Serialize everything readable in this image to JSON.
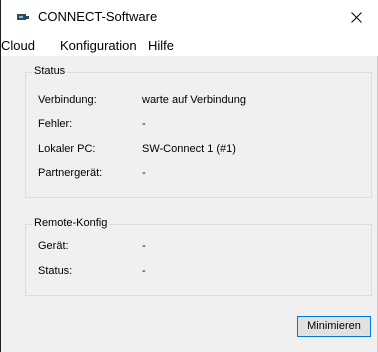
{
  "window": {
    "title": "CONNECT-Software",
    "close_symbol": "✕"
  },
  "menu": {
    "items": [
      "Cloud",
      "Konfiguration",
      "Hilfe"
    ]
  },
  "status": {
    "legend": "Status",
    "rows": [
      {
        "label": "Verbindung:",
        "value": "warte auf Verbindung"
      },
      {
        "label": "Fehler:",
        "value": "-"
      },
      {
        "label": "Lokaler PC:",
        "value": "SW-Connect 1 (#1)"
      },
      {
        "label": "Partnergerät:",
        "value": "-"
      }
    ]
  },
  "remote": {
    "legend": "Remote-Konfig",
    "rows": [
      {
        "label": "Gerät:",
        "value": "-"
      },
      {
        "label": "Status:",
        "value": "-"
      }
    ]
  },
  "actions": {
    "minimize_label": "Minimieren"
  },
  "icons": {
    "app": "device-icon",
    "close": "close-icon"
  },
  "colors": {
    "button_border": "#0078d7",
    "window_bg": "#f0f0f0"
  }
}
